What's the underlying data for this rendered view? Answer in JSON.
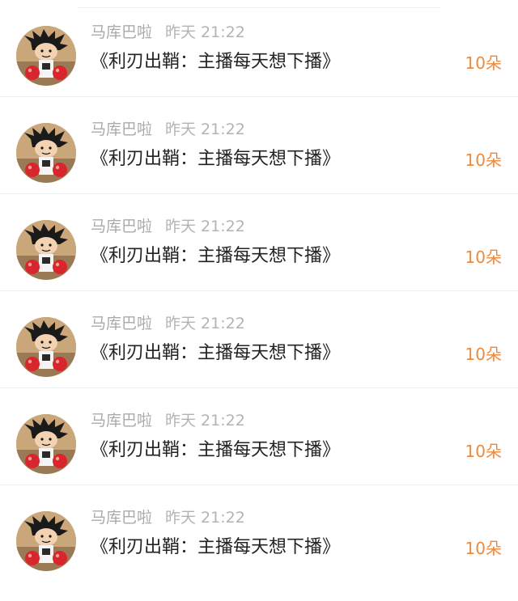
{
  "gift_list": {
    "items": [
      {
        "username": "马库巴啦",
        "time": "昨天 21:22",
        "title": "《利刃出鞘：主播每天想下播》",
        "gift_count": "10朵"
      },
      {
        "username": "马库巴啦",
        "time": "昨天 21:22",
        "title": "《利刃出鞘：主播每天想下播》",
        "gift_count": "10朵"
      },
      {
        "username": "马库巴啦",
        "time": "昨天 21:22",
        "title": "《利刃出鞘：主播每天想下播》",
        "gift_count": "10朵"
      },
      {
        "username": "马库巴啦",
        "time": "昨天 21:22",
        "title": "《利刃出鞘：主播每天想下播》",
        "gift_count": "10朵"
      },
      {
        "username": "马库巴啦",
        "time": "昨天 21:22",
        "title": "《利刃出鞘：主播每天想下播》",
        "gift_count": "10朵"
      },
      {
        "username": "马库巴啦",
        "time": "昨天 21:22",
        "title": "《利刃出鞘：主播每天想下播》",
        "gift_count": "10朵"
      }
    ]
  },
  "colors": {
    "gift_count": "#f0883a",
    "meta_text": "#aaaaaa",
    "title_text": "#222222",
    "divider": "#f0f0f0"
  },
  "icons": {
    "avatar": "cartoon-boy-avatar"
  }
}
